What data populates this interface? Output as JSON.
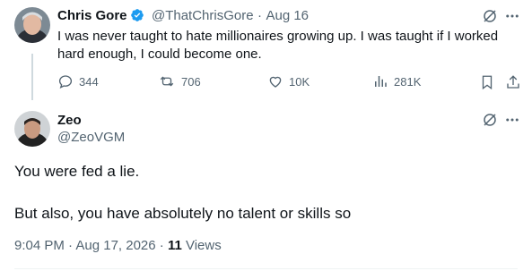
{
  "quoted_tweet": {
    "author_name": "Chris Gore",
    "handle": "@ThatChrisGore",
    "separator": "·",
    "date": "Aug 16",
    "text_line1": "I was never taught to hate millionaires growing up. I was taught if I worked",
    "text_line2": "hard enough, I could become one.",
    "replies": "344",
    "retweets": "706",
    "likes": "10K",
    "views": "281K"
  },
  "reply_tweet": {
    "author_name": "Zeo",
    "handle": "@ZeoVGM",
    "line1": "You were fed a lie.",
    "line2": "But also, you have absolutely no talent or skills so",
    "timestamp": "9:04 PM · Aug 17, 2026 · ",
    "views_count": "11",
    "views_label": " Views"
  },
  "colors": {
    "verified": "#1d9bf0",
    "muted": "#536471",
    "text": "#0f1419",
    "line": "#cfd9de"
  },
  "icons": [
    "grok-icon",
    "more-icon",
    "reply-icon",
    "retweet-icon",
    "like-icon",
    "views-icon",
    "bookmark-icon",
    "share-icon",
    "verified-badge-icon"
  ]
}
